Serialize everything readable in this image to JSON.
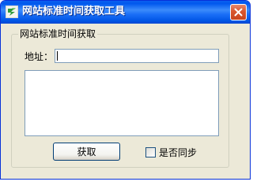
{
  "window": {
    "title": "网站标准时间获取工具",
    "icon": "app-icon",
    "close_icon": "close-icon"
  },
  "group": {
    "title": "网站标准时间获取"
  },
  "address": {
    "label": "地址：",
    "value": "",
    "placeholder": ""
  },
  "output": {
    "value": ""
  },
  "fetch_button": {
    "label": "获取"
  },
  "sync": {
    "label": "是否同步",
    "checked": false
  },
  "colors": {
    "titlebar": "#0058ee",
    "window_bg": "#ece9d8",
    "close_button": "#d9562e",
    "input_border": "#7f9db9"
  }
}
